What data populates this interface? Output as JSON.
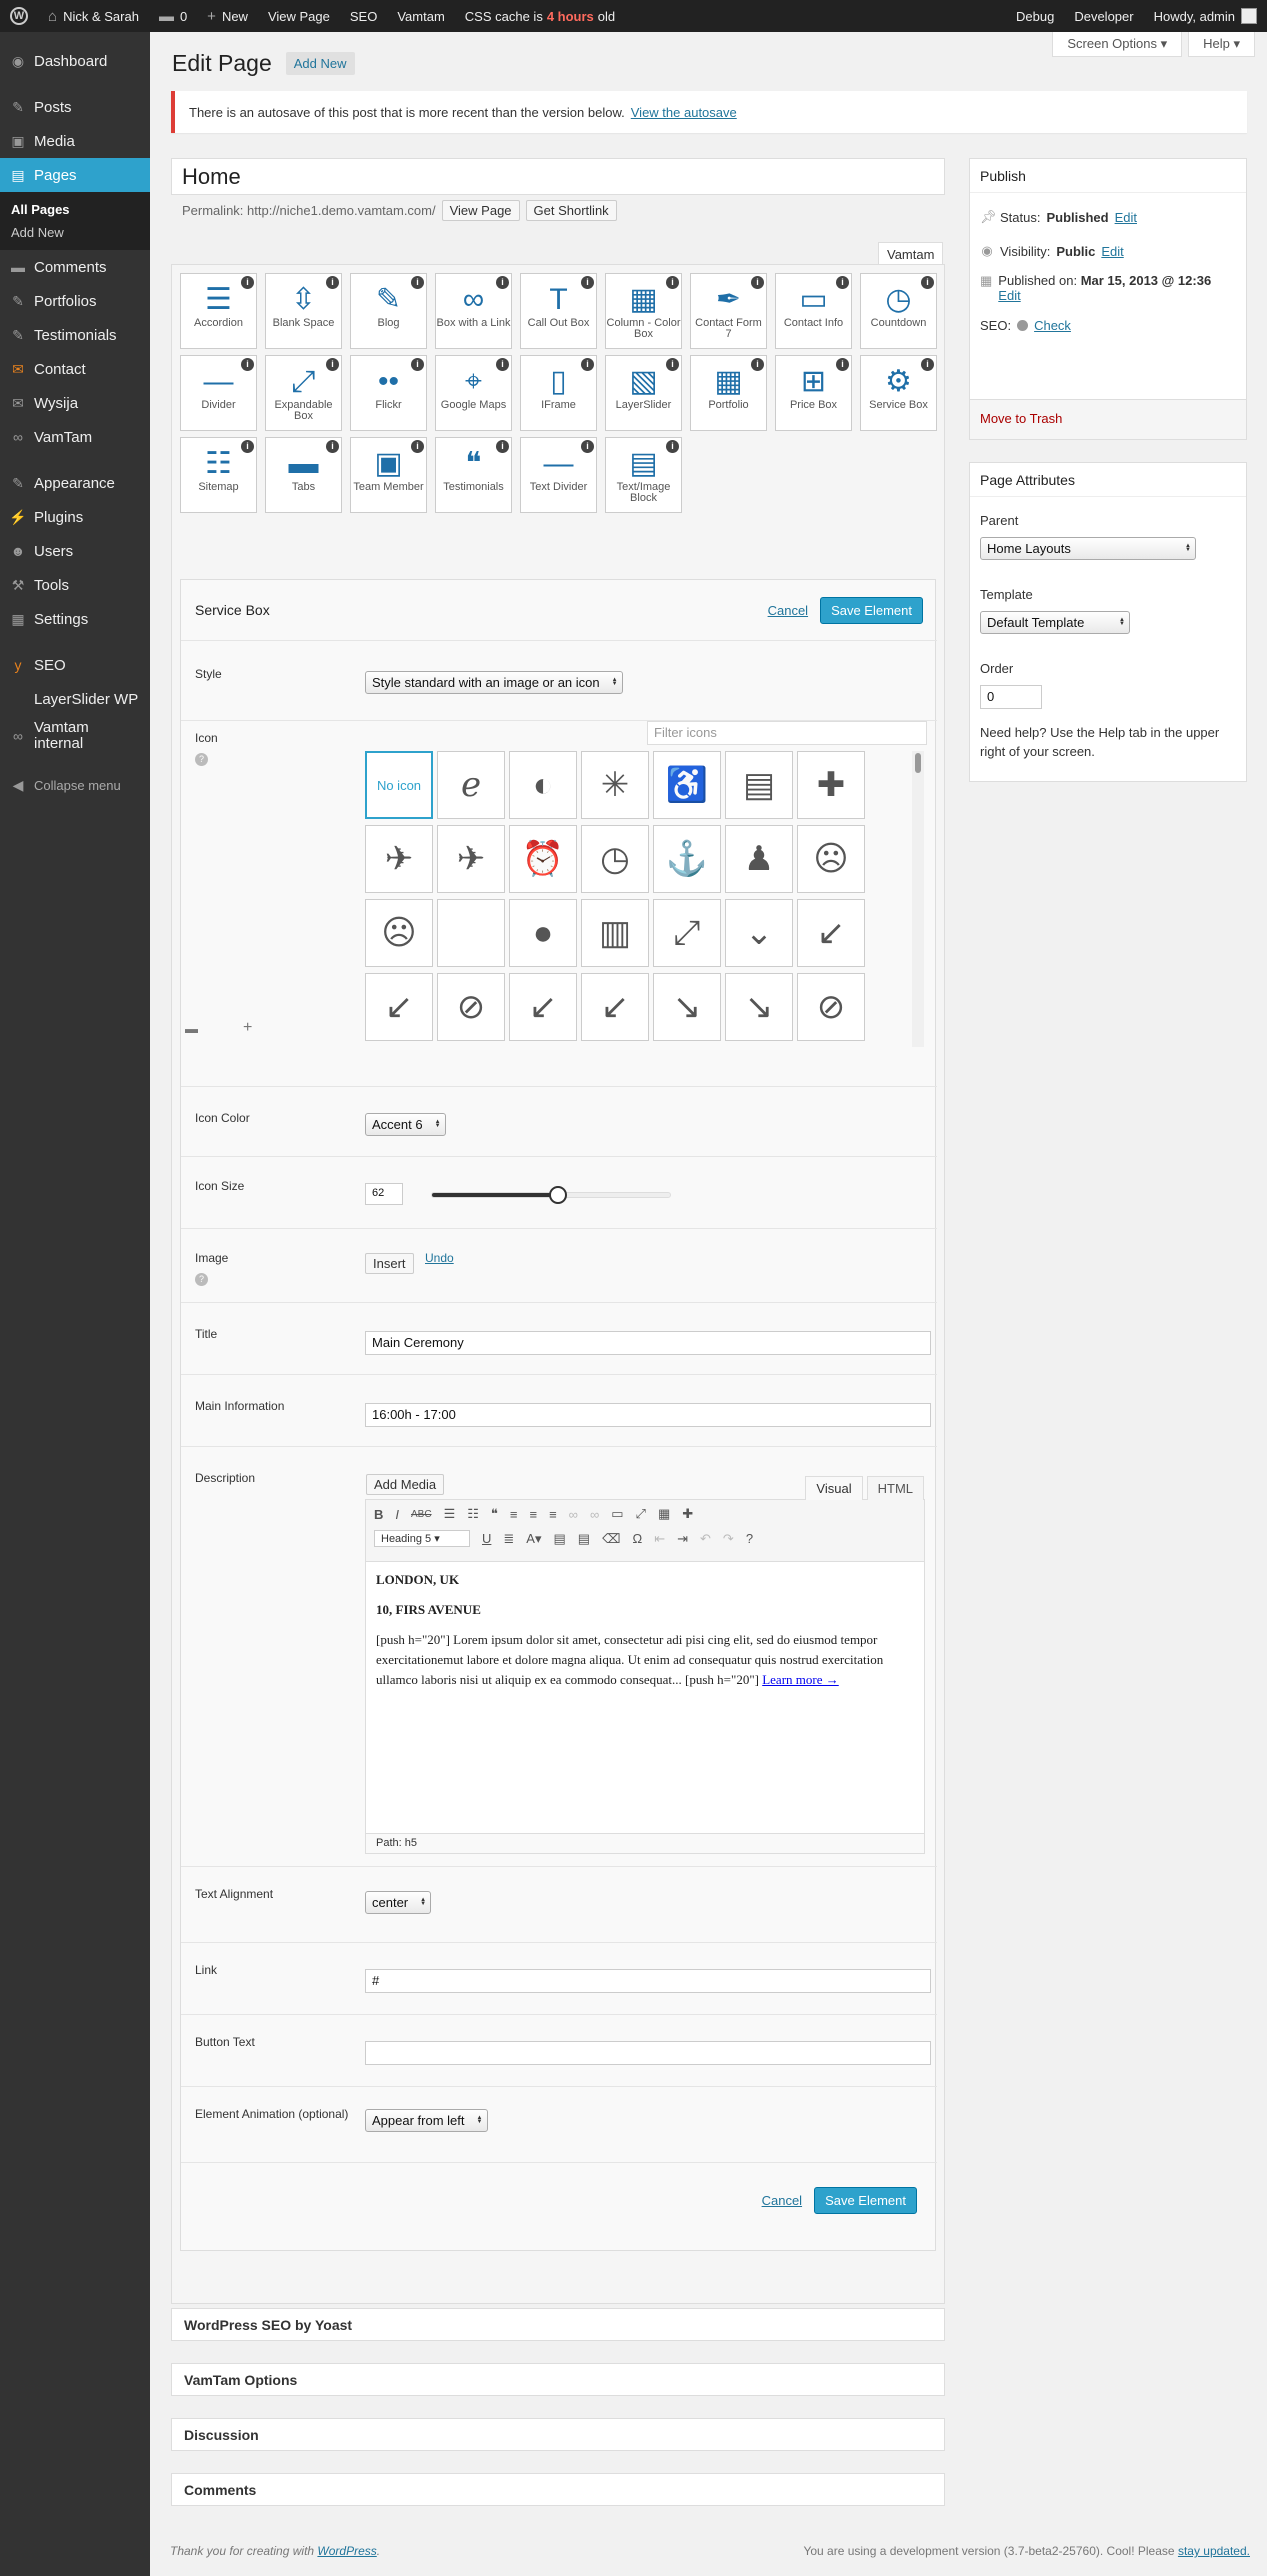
{
  "adminbar": {
    "site_name": "Nick & Sarah",
    "comments_count": "0",
    "new_label": "New",
    "view_page": "View Page",
    "seo": "SEO",
    "vamtam": "Vamtam",
    "cache_prefix": "CSS cache is",
    "cache_age": "4 hours",
    "cache_suffix": "old",
    "debug": "Debug",
    "developer": "Developer",
    "howdy": "Howdy, admin"
  },
  "sidebar": {
    "items": [
      {
        "label": "Dashboard",
        "icon": "dashboard-icon"
      },
      {
        "label": "Posts",
        "icon": "pin-icon"
      },
      {
        "label": "Media",
        "icon": "media-icon"
      },
      {
        "label": "Pages",
        "icon": "pages-icon"
      },
      {
        "label": "Comments",
        "icon": "comments-icon"
      },
      {
        "label": "Portfolios",
        "icon": "pin-icon"
      },
      {
        "label": "Testimonials",
        "icon": "pin-icon"
      },
      {
        "label": "Contact",
        "icon": "contact-icon"
      },
      {
        "label": "Wysija",
        "icon": "wysija-icon"
      },
      {
        "label": "VamTam",
        "icon": "vamtam-icon"
      },
      {
        "label": "Appearance",
        "icon": "appearance-icon"
      },
      {
        "label": "Plugins",
        "icon": "plugins-icon"
      },
      {
        "label": "Users",
        "icon": "users-icon"
      },
      {
        "label": "Tools",
        "icon": "tools-icon"
      },
      {
        "label": "Settings",
        "icon": "settings-icon"
      },
      {
        "label": "SEO",
        "icon": "seo-icon"
      },
      {
        "label": "LayerSlider WP",
        "icon": "layerslider-icon"
      },
      {
        "label": "Vamtam internal",
        "icon": "vamtam-icon"
      }
    ],
    "submenu": [
      "All Pages",
      "Add New"
    ],
    "collapse": "Collapse menu"
  },
  "header": {
    "screen_options": "Screen Options",
    "help": "Help",
    "title": "Edit Page",
    "add_new": "Add New",
    "notice_text": "There is an autosave of this post that is more recent than the version below.",
    "notice_link": "View the autosave"
  },
  "post": {
    "title": "Home",
    "permalink_label": "Permalink: http://niche1.demo.vamtam.com/",
    "view_page_btn": "View Page",
    "shortlink_btn": "Get Shortlink",
    "vamtam_tab": "Vamtam"
  },
  "palette": [
    {
      "label": "Accordion",
      "icon": "accordion-icon",
      "glyph": "☰"
    },
    {
      "label": "Blank Space",
      "icon": "blank-space-icon",
      "glyph": "⇳"
    },
    {
      "label": "Blog",
      "icon": "blog-icon",
      "glyph": "✎"
    },
    {
      "label": "Box with a Link",
      "icon": "link-icon",
      "glyph": "∞"
    },
    {
      "label": "Call Out Box",
      "icon": "callout-icon",
      "glyph": "T"
    },
    {
      "label": "Column - Color Box",
      "icon": "column-icon",
      "glyph": "▦"
    },
    {
      "label": "Contact Form 7",
      "icon": "contact-form-icon",
      "glyph": "✒"
    },
    {
      "label": "Contact Info",
      "icon": "contact-info-icon",
      "glyph": "▭"
    },
    {
      "label": "Countdown",
      "icon": "countdown-icon",
      "glyph": "◷"
    },
    {
      "label": "Divider",
      "icon": "divider-icon",
      "glyph": "—"
    },
    {
      "label": "Expandable Box",
      "icon": "expand-icon",
      "glyph": "⤢"
    },
    {
      "label": "Flickr",
      "icon": "flickr-icon",
      "glyph": "••"
    },
    {
      "label": "Google Maps",
      "icon": "map-pin-icon",
      "glyph": "⌖"
    },
    {
      "label": "IFrame",
      "icon": "iframe-icon",
      "glyph": "▯"
    },
    {
      "label": "LayerSlider",
      "icon": "layerslider-icon",
      "glyph": "▧"
    },
    {
      "label": "Portfolio",
      "icon": "portfolio-icon",
      "glyph": "▦"
    },
    {
      "label": "Price Box",
      "icon": "basket-icon",
      "glyph": "⊞"
    },
    {
      "label": "Service Box",
      "icon": "gear-icon",
      "glyph": "⚙"
    },
    {
      "label": "Sitemap",
      "icon": "sitemap-icon",
      "glyph": "☷"
    },
    {
      "label": "Tabs",
      "icon": "tabs-icon",
      "glyph": "▬"
    },
    {
      "label": "Team Member",
      "icon": "team-icon",
      "glyph": "▣"
    },
    {
      "label": "Testimonials",
      "icon": "quote-icon",
      "glyph": "❝"
    },
    {
      "label": "Text Divider",
      "icon": "text-divider-icon",
      "glyph": "—"
    },
    {
      "label": "Text/Image Block",
      "icon": "document-icon",
      "glyph": "▤"
    }
  ],
  "service_box": {
    "title": "Service Box",
    "cancel": "Cancel",
    "save": "Save Element",
    "style_label": "Style",
    "style_value": "Style standard with an image or an icon",
    "icon_label": "Icon",
    "filter_placeholder": "Filter icons",
    "no_icon": "No icon",
    "icons": [
      {
        "name": "internet-explorer-icon",
        "g": "ℯ"
      },
      {
        "name": "eye-icon",
        "g": "◐"
      },
      {
        "name": "accessibility-icon",
        "g": "✳"
      },
      {
        "name": "wheelchair-icon",
        "g": "♿"
      },
      {
        "name": "address-book-icon",
        "g": "▤"
      },
      {
        "name": "first-aid-icon",
        "g": "✚"
      },
      {
        "name": "airplane-icon",
        "g": "✈"
      },
      {
        "name": "airplane-alt-icon",
        "g": "✈"
      },
      {
        "name": "alarm-icon",
        "g": "⏰"
      },
      {
        "name": "alarm-clock-icon",
        "g": "◷"
      },
      {
        "name": "anchor-icon",
        "g": "⚓"
      },
      {
        "name": "android-icon",
        "g": "♟"
      },
      {
        "name": "angry-icon",
        "g": "☹"
      },
      {
        "name": "angry-face-icon",
        "g": "☹"
      },
      {
        "name": "apple-icon",
        "g": ""
      },
      {
        "name": "apple-fruit-icon",
        "g": "●"
      },
      {
        "name": "archive-icon",
        "g": "▥"
      },
      {
        "name": "arrow-expand-icon",
        "g": "⤢"
      },
      {
        "name": "chevron-down-icon",
        "g": "⌄"
      },
      {
        "name": "arrow-down-left-icon",
        "g": "↙"
      },
      {
        "name": "arrow-down-left-thin-icon",
        "g": "↙"
      },
      {
        "name": "arrow-circle-icon",
        "g": "⊘"
      },
      {
        "name": "arrow-down-left-bold-icon",
        "g": "↙"
      },
      {
        "name": "arrow-down-left-alt-icon",
        "g": "↙"
      },
      {
        "name": "arrow-down-right-icon",
        "g": "↘"
      },
      {
        "name": "arrow-down-right-thin-icon",
        "g": "↘"
      },
      {
        "name": "arrow-circle-right-icon",
        "g": "⊘"
      }
    ],
    "icon_color_label": "Icon Color",
    "icon_color_value": "Accent 6",
    "icon_size_label": "Icon Size",
    "icon_size_value": "62",
    "icon_size_fraction": 0.53,
    "image_label": "Image",
    "insert_btn": "Insert",
    "undo_link": "Undo",
    "title_label": "Title",
    "title_value": "Main Ceremony",
    "main_info_label": "Main Information",
    "main_info_value": "16:00h - 17:00",
    "description_label": "Description",
    "add_media": "Add Media",
    "tab_visual": "Visual",
    "tab_html": "HTML",
    "format_select": "Heading 5",
    "desc_line1": "LONDON,  UK",
    "desc_line2": "10, FIRS AVENUE",
    "desc_para": "[push h=\"20\"] Lorem ipsum dolor sit amet, consectetur adi pisi cing elit, sed do eiusmod tempor exercitationemut labore et dolore magna aliqua. Ut enim ad consequatur quis nostrud exercitation ullamco laboris nisi ut aliquip ex ea commodo consequat... [push h=\"20\"]",
    "desc_link": "Learn more →",
    "path": "Path: h5",
    "text_align_label": "Text Alignment",
    "text_align_value": "center",
    "link_label": "Link",
    "link_value": "#",
    "button_text_label": "Button Text",
    "button_text_value": "",
    "animation_label": "Element Animation (optional)",
    "animation_value": "Appear from left"
  },
  "publish": {
    "title": "Publish",
    "status_label": "Status:",
    "status_value": "Published",
    "visibility_label": "Visibility:",
    "visibility_value": "Public",
    "published_label": "Published on:",
    "published_value": "Mar 15, 2013 @ 12:36",
    "edit": "Edit",
    "seo_label": "SEO:",
    "seo_check": "Check",
    "trash": "Move to Trash"
  },
  "page_attributes": {
    "title": "Page Attributes",
    "parent_label": "Parent",
    "parent_value": "Home Layouts",
    "template_label": "Template",
    "template_value": "Default Template",
    "order_label": "Order",
    "order_value": "0",
    "help_text": "Need help? Use the Help tab in the upper right of your screen."
  },
  "postboxes": [
    "WordPress SEO by Yoast",
    "VamTam Options",
    "Discussion",
    "Comments"
  ],
  "footer": {
    "thanks_prefix": "Thank you for creating with",
    "thanks_link": "WordPress",
    "version_text": "You are using a development version (3.7-beta2-25760). Cool! Please",
    "stay_updated": "stay updated."
  }
}
